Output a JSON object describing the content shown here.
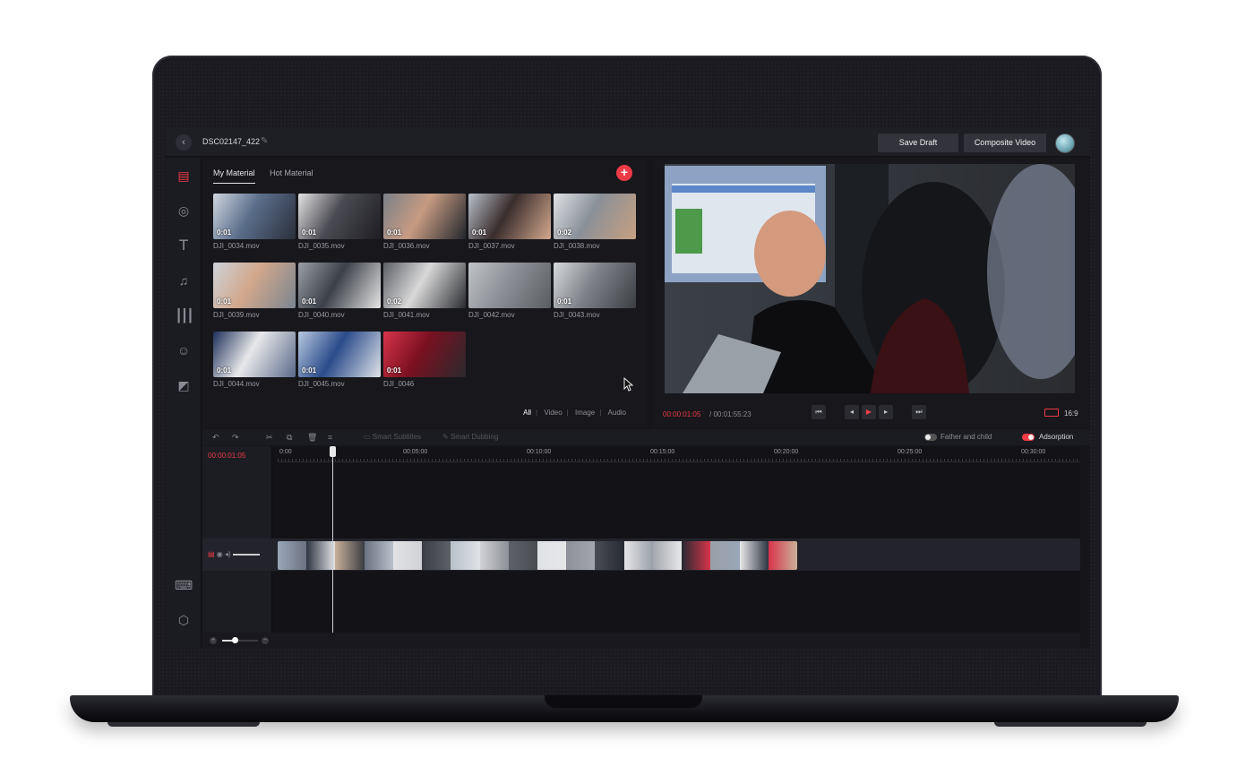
{
  "header": {
    "document_title": "DSC02147_422",
    "save_draft_label": "Save Draft",
    "composite_video_label": "Composite Video"
  },
  "sidebar": {
    "items": [
      {
        "icon": "clapperboard-icon",
        "active": true
      },
      {
        "icon": "sticker-icon"
      },
      {
        "icon": "text-icon"
      },
      {
        "icon": "music-icon"
      },
      {
        "icon": "audio-wave-icon"
      },
      {
        "icon": "emoji-icon"
      },
      {
        "icon": "image-transition-icon"
      },
      {
        "icon": "keyboard-icon"
      },
      {
        "icon": "settings-icon"
      },
      {
        "icon": "help-icon"
      }
    ]
  },
  "material": {
    "tabs": [
      "My Material",
      "Hot Material"
    ],
    "clips": [
      {
        "name": "DJI_0034.mov",
        "duration": "0:01"
      },
      {
        "name": "DJI_0035.mov",
        "duration": "0:01"
      },
      {
        "name": "DJI_0036.mov",
        "duration": "0:01"
      },
      {
        "name": "DJI_0037.mov",
        "duration": "0:01"
      },
      {
        "name": "DJI_0038.mov",
        "duration": "0:02"
      },
      {
        "name": "DJI_0039.mov",
        "duration": "0:01"
      },
      {
        "name": "DJI_0040.mov",
        "duration": "0:01"
      },
      {
        "name": "DJI_0041.mov",
        "duration": "0:02"
      },
      {
        "name": "DJI_0042.mov",
        "duration": ""
      },
      {
        "name": "DJI_0043.mov",
        "duration": "0:01"
      },
      {
        "name": "DJI_0044.mov",
        "duration": "0:01"
      },
      {
        "name": "DJI_0045.mov",
        "duration": "0:01"
      },
      {
        "name": "DJI_0046",
        "duration": "0:01"
      }
    ],
    "filters": [
      "All",
      "Video",
      "Image",
      "Audio"
    ],
    "active_filter": "All"
  },
  "preview": {
    "current_time": "00:00:01:05",
    "total_time": "/ 00:01:55:23",
    "aspect_ratio": "16:9"
  },
  "timeline": {
    "tools": {
      "smart_subtitles": "Smart Subtitles",
      "smart_dubbing": "Smart Dubbing",
      "father_and_child": "Father and child",
      "adsorption": "Adsorption"
    },
    "father_and_child_on": false,
    "adsorption_on": true,
    "current_time": "00:00:01:05",
    "ruler_ticks": [
      "0:00",
      "00:05:00",
      "00:10:00",
      "00:15:00",
      "00:20:00",
      "00:25:00",
      "00:30:00"
    ],
    "zoom_level": 0.35
  },
  "colors": {
    "accent": "#ee3b46",
    "background": "#15151a",
    "panel": "#17171c"
  }
}
